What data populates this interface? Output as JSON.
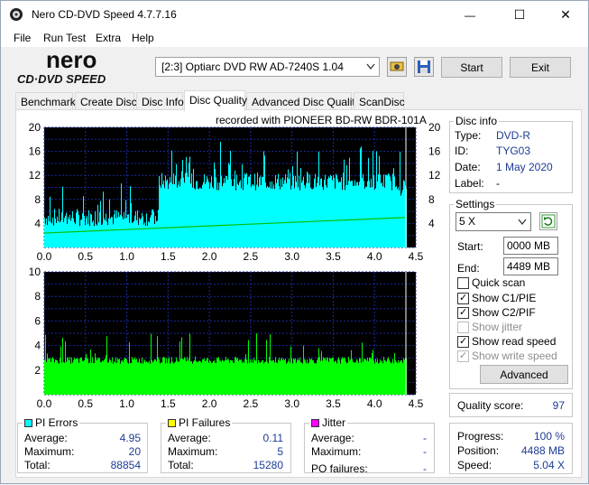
{
  "window": {
    "title": "Nero CD-DVD Speed 4.7.7.16",
    "minimize": "—",
    "maximize": "☐",
    "close": "✕"
  },
  "menu": [
    "File",
    "Run Test",
    "Extra",
    "Help"
  ],
  "logo": {
    "top": "nero",
    "bottom": "CD·DVD SPEED"
  },
  "toolbar": {
    "drive": "[2:3]   Optiarc DVD RW AD-7240S 1.04",
    "start_label": "Start",
    "exit_label": "Exit"
  },
  "tabs": [
    "Benchmark",
    "Create Disc",
    "Disc Info",
    "Disc Quality",
    "Advanced Disc Quality",
    "ScanDisc"
  ],
  "active_tab": "Disc Quality",
  "recorded_with": "recorded with PIONEER  BD-RW   BDR-101A",
  "disc_info": {
    "title": "Disc info",
    "type_label": "Type:",
    "type": "DVD-R",
    "id_label": "ID:",
    "id": "TYG03",
    "date_label": "Date:",
    "date": "1 May 2020",
    "label_label": "Label:",
    "label": "-"
  },
  "settings": {
    "title": "Settings",
    "speed": "5 X",
    "start_label": "Start:",
    "start": "0000 MB",
    "end_label": "End:",
    "end": "4489 MB",
    "quick_scan": "Quick scan",
    "show_c1": "Show C1/PIE",
    "show_c2": "Show C2/PIF",
    "show_jitter": "Show jitter",
    "show_read": "Show read speed",
    "show_write": "Show write speed",
    "advanced": "Advanced"
  },
  "quality": {
    "label": "Quality score:",
    "value": "97"
  },
  "progress": {
    "progress_label": "Progress:",
    "progress": "100 %",
    "position_label": "Position:",
    "position": "4488 MB",
    "speed_label": "Speed:",
    "speed": "5.04 X"
  },
  "pi_errors": {
    "title": "PI Errors",
    "color": "#00ffff",
    "average_label": "Average:",
    "average": "4.95",
    "maximum_label": "Maximum:",
    "maximum": "20",
    "total_label": "Total:",
    "total": "88854"
  },
  "pi_failures": {
    "title": "PI Failures",
    "color": "#ffff00",
    "average_label": "Average:",
    "average": "0.11",
    "maximum_label": "Maximum:",
    "maximum": "5",
    "total_label": "Total:",
    "total": "15280"
  },
  "jitter": {
    "title": "Jitter",
    "color": "#ff00ff",
    "average_label": "Average:",
    "average": "-",
    "maximum_label": "Maximum:",
    "maximum": "-",
    "po_label": "PO failures:",
    "po": "-"
  },
  "chart_data": [
    {
      "type": "area",
      "x_ticks": [
        "0.0",
        "0.5",
        "1.0",
        "1.5",
        "2.0",
        "2.5",
        "3.0",
        "3.5",
        "4.0",
        "4.5"
      ],
      "y_ticks": [
        "20",
        "16",
        "12",
        "8",
        "4"
      ],
      "xlim": [
        0,
        4.5
      ],
      "ylim": [
        0,
        20
      ],
      "series": [
        {
          "color": "#00ffff",
          "segments": [
            [
              0,
              1.38,
              5
            ],
            [
              1.38,
              4.3,
              11
            ],
            [
              4.3,
              4.38,
              10
            ]
          ]
        },
        {
          "color": "#00c000",
          "kind": "read-speed-line",
          "x": [
            0,
            4.38
          ],
          "y": [
            2.4,
            5.0
          ]
        }
      ],
      "grid": true
    },
    {
      "type": "bar",
      "x_ticks": [
        "0.0",
        "0.5",
        "1.0",
        "1.5",
        "2.0",
        "2.5",
        "3.0",
        "3.5",
        "4.0",
        "4.5"
      ],
      "y_ticks": [
        "10",
        "8",
        "6",
        "4",
        "2"
      ],
      "xlim": [
        0,
        4.5
      ],
      "ylim": [
        0,
        10
      ],
      "series": [
        {
          "color": "#00ff00",
          "baseline": 2.8,
          "max": 5
        }
      ],
      "grid": true
    }
  ]
}
